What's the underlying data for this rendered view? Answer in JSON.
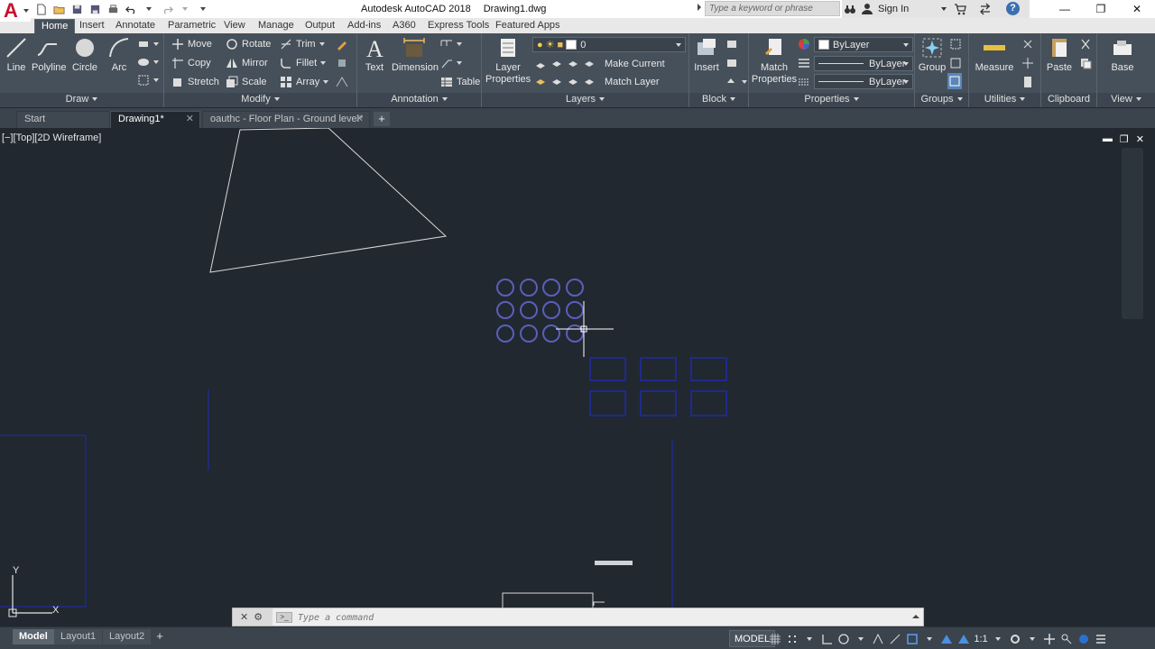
{
  "app": {
    "title": "Autodesk AutoCAD 2018",
    "document": "Drawing1.dwg",
    "logo_letter": "A"
  },
  "search": {
    "placeholder": "Type a keyword or phrase"
  },
  "account": {
    "signin_label": "Sign In"
  },
  "help_label": "?",
  "ribbon_tabs": [
    "Home",
    "Insert",
    "Annotate",
    "Parametric",
    "View",
    "Manage",
    "Output",
    "Add-ins",
    "A360",
    "Express Tools",
    "Featured Apps"
  ],
  "ribbon": {
    "draw": {
      "title": "Draw",
      "line": "Line",
      "polyline": "Polyline",
      "circle": "Circle",
      "arc": "Arc"
    },
    "modify": {
      "title": "Modify",
      "move": "Move",
      "rotate": "Rotate",
      "trim": "Trim",
      "copy": "Copy",
      "mirror": "Mirror",
      "fillet": "Fillet",
      "stretch": "Stretch",
      "scale": "Scale",
      "array": "Array"
    },
    "annotation": {
      "title": "Annotation",
      "text": "Text",
      "dimension": "Dimension",
      "table": "Table"
    },
    "layers": {
      "title": "Layers",
      "layer_properties_line1": "Layer",
      "layer_properties_line2": "Properties",
      "current_layer": "0",
      "make_current": "Make Current",
      "match_layer": "Match Layer"
    },
    "block": {
      "title": "Block",
      "insert": "Insert"
    },
    "properties": {
      "title": "Properties",
      "match_line1": "Match",
      "match_line2": "Properties",
      "color": "ByLayer",
      "linetype": "ByLayer",
      "lineweight": "ByLayer"
    },
    "groups": {
      "title": "Groups",
      "group": "Group"
    },
    "utilities": {
      "title": "Utilities",
      "measure": "Measure"
    },
    "clipboard": {
      "title": "Clipboard",
      "paste": "Paste"
    },
    "view": {
      "title": "View",
      "base": "Base"
    }
  },
  "file_tabs": [
    {
      "label": "Start"
    },
    {
      "label": "Drawing1*"
    },
    {
      "label": "oauthc - Floor Plan - Ground level*"
    }
  ],
  "viewport": {
    "label": "[−][Top][2D Wireframe]"
  },
  "ucs": {
    "x_label": "X",
    "y_label": "Y"
  },
  "command": {
    "placeholder": "Type a command"
  },
  "layout_tabs": [
    "Model",
    "Layout1",
    "Layout2"
  ],
  "status": {
    "model_label": "MODEL",
    "scale_label": "1:1"
  },
  "colors": {
    "canvas": "#212830",
    "ribbon": "#46505a",
    "circles": "#5a5fb8",
    "rects": "#1f2a8a",
    "accent_red": "#c8102e"
  }
}
